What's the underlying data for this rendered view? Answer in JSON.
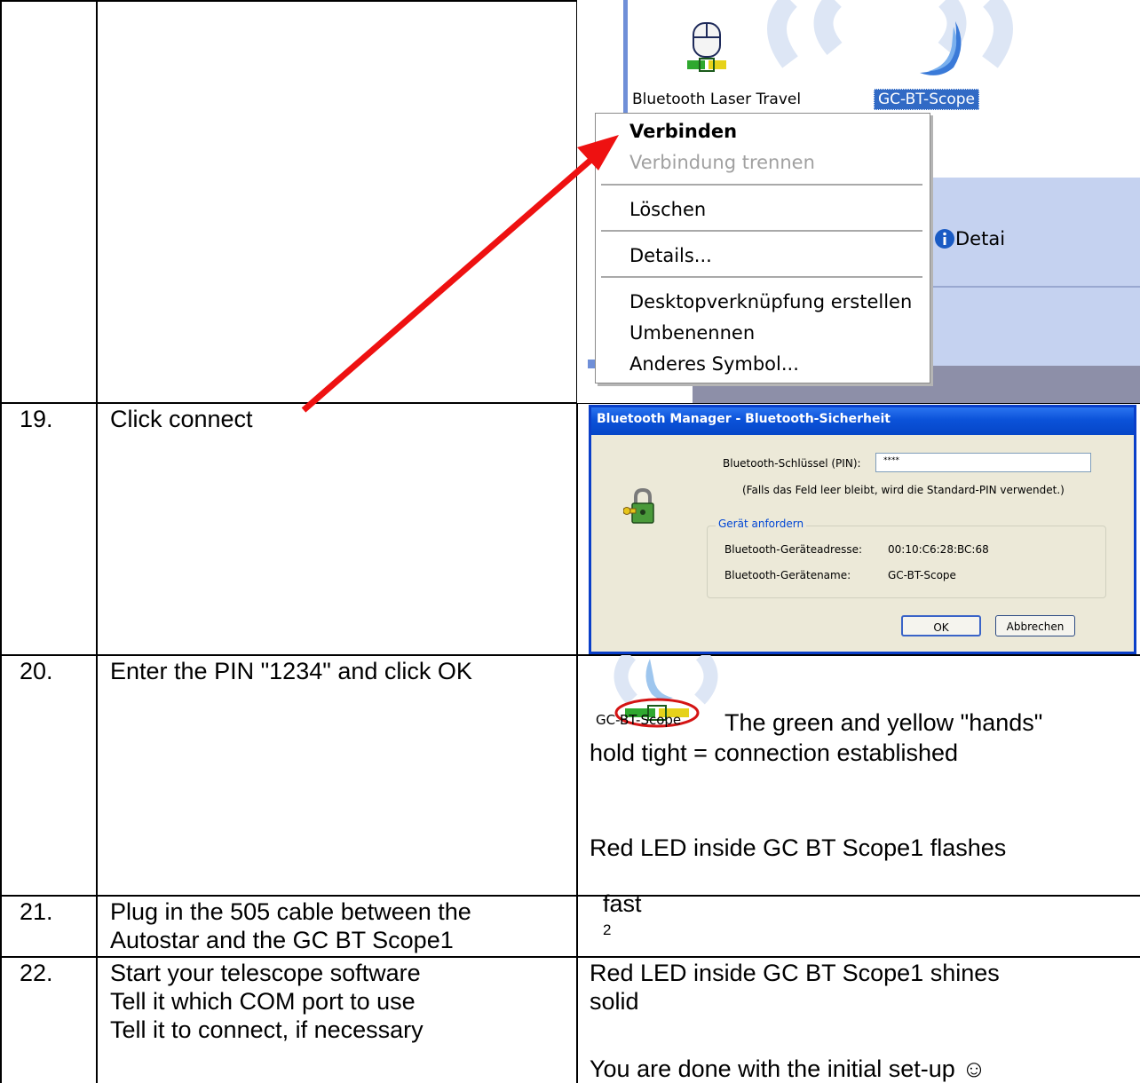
{
  "rows": [
    {
      "num": "19.",
      "instruction": [
        "Click connect"
      ]
    },
    {
      "num": "20.",
      "instruction": [
        "Enter the PIN \"1234\" and click OK"
      ]
    },
    {
      "num": "21.",
      "instruction": [
        "Plug in the 505 cable between the",
        "Autostar and the GC BT Scope1"
      ]
    },
    {
      "num": "22.",
      "instruction": [
        "Start your telescope software",
        "Tell it which COM port to use",
        "Tell it to connect, if necessary"
      ]
    }
  ],
  "result_20": {
    "line1_suffix": "The green and yellow \"hands\"",
    "line2": "hold tight = connection established",
    "line3": "Red LED inside GC BT Scope1 flashes",
    "line4": "fast",
    "footnote": "2"
  },
  "result_22": {
    "line1": "Red LED inside GC BT Scope1 shines",
    "line2": "solid",
    "line3": "You are done with the initial set-up ☺"
  },
  "explorer": {
    "device1_label": "Bluetooth Laser Travel",
    "device2_label": "GC-BT-Scope",
    "details_fragment": "Detai"
  },
  "context_menu": {
    "connect": "Verbinden",
    "disconnect": "Verbindung trennen",
    "delete": "Löschen",
    "details": "Details...",
    "shortcut": "Desktopverknüpfung erstellen",
    "rename": "Umbenennen",
    "other_icon": "Anderes Symbol..."
  },
  "dialog": {
    "title": "Bluetooth Manager - Bluetooth-Sicherheit",
    "pin_label": "Bluetooth-Schlüssel (PIN):",
    "pin_value": "****",
    "hint": "(Falls das Feld leer bleibt, wird die Standard-PIN verwendet.)",
    "group_title": "Gerät anfordern",
    "address_label": "Bluetooth-Geräteadresse:",
    "address_value": "00:10:C6:28:BC:68",
    "name_label": "Bluetooth-Gerätename:",
    "name_value": "GC-BT-Scope",
    "ok_label": "OK",
    "cancel_label": "Abbrechen"
  },
  "icon_caption": "GC-BT-Scope",
  "colors": {
    "arrow": "#ee1111",
    "xp_title": "#0b52d9",
    "dialog_bg": "#ece9d8",
    "highlight": "#316ac5"
  },
  "icons": {
    "padlock": "padlock-key-icon",
    "mouse": "mouse-device-icon",
    "moon": "moon-device-icon",
    "info": "info-icon"
  }
}
